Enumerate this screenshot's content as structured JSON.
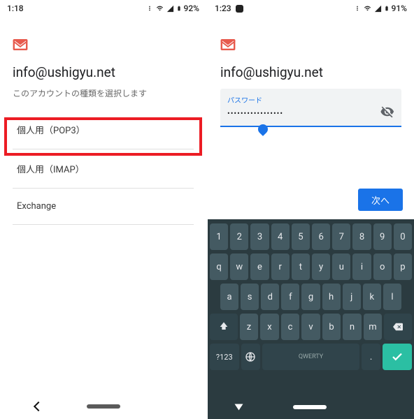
{
  "left": {
    "statusbar": {
      "time": "1:18",
      "battery": "92%"
    },
    "email": "info@ushigyu.net",
    "subtitle": "このアカウントの種類を選択します",
    "options": {
      "pop3": "個人用（POP3）",
      "imap": "個人用（IMAP）",
      "exchange": "Exchange"
    }
  },
  "right": {
    "statusbar": {
      "time": "1:23",
      "battery": "91%"
    },
    "email": "info@ushigyu.net",
    "password_label": "パスワード",
    "password_value": "•••••••••••••••••",
    "next": "次へ",
    "keyboard": {
      "row_num": [
        "1",
        "2",
        "3",
        "4",
        "5",
        "6",
        "7",
        "8",
        "9",
        "0"
      ],
      "row_q": [
        "q",
        "w",
        "e",
        "r",
        "t",
        "y",
        "u",
        "i",
        "o",
        "p"
      ],
      "row_a": [
        "a",
        "s",
        "d",
        "f",
        "g",
        "h",
        "j",
        "k",
        "l"
      ],
      "row_z": [
        "z",
        "x",
        "c",
        "v",
        "b",
        "n",
        "m"
      ],
      "sym": "?123",
      "space": "QWERTY"
    }
  }
}
